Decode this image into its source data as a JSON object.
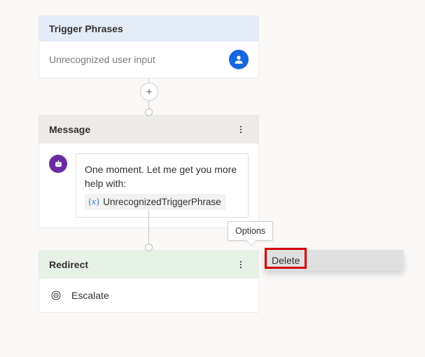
{
  "trigger": {
    "header": "Trigger Phrases",
    "body": "Unrecognized user input"
  },
  "message": {
    "header": "Message",
    "text": "One moment. Let me get you more help with:",
    "variable_symbol": "x",
    "variable_name": "UnrecognizedTriggerPhrase"
  },
  "redirect": {
    "header": "Redirect",
    "action": "Escalate"
  },
  "tooltip": "Options",
  "menu": {
    "delete": "Delete"
  },
  "add_label": "+"
}
